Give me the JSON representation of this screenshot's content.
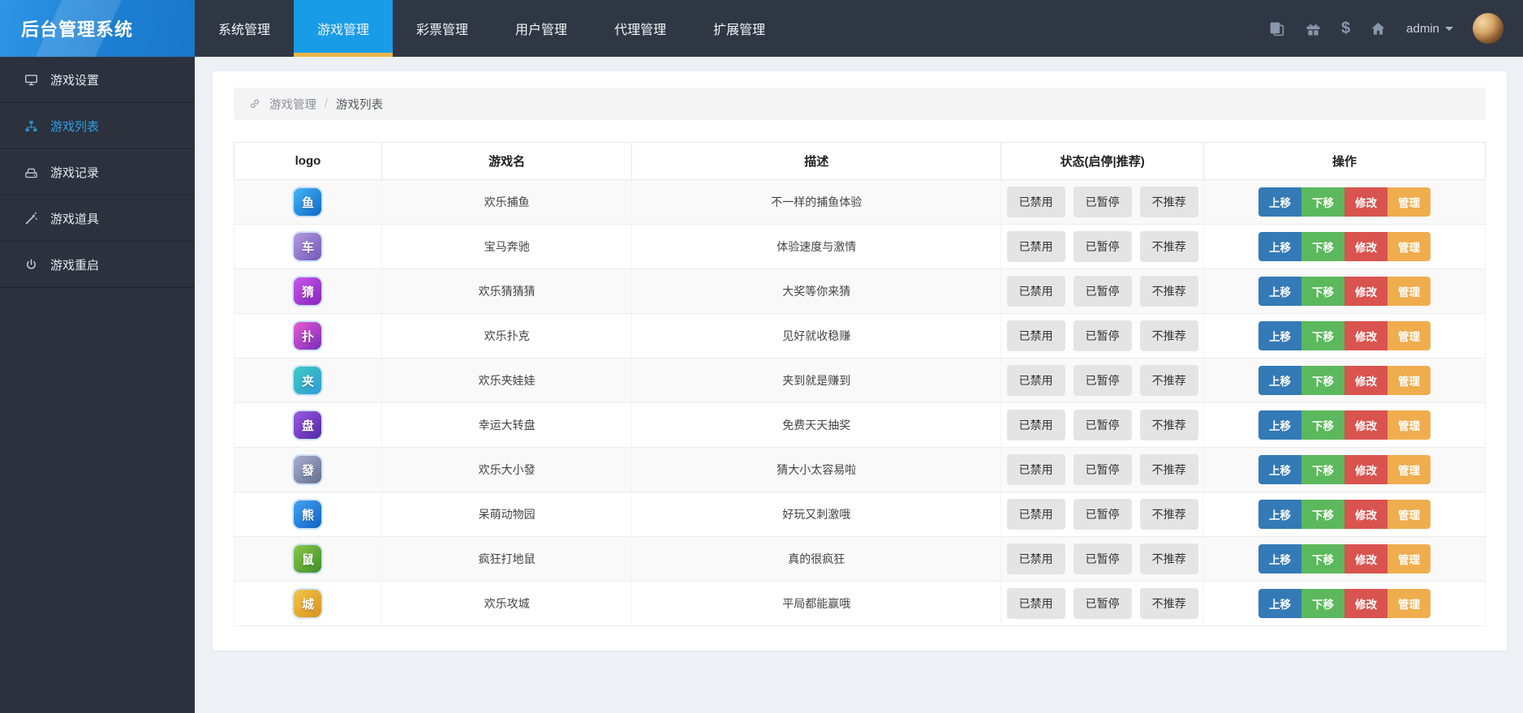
{
  "app": {
    "title": "后台管理系统"
  },
  "topnav": {
    "items": [
      {
        "label": "系统管理",
        "active": false
      },
      {
        "label": "游戏管理",
        "active": true
      },
      {
        "label": "彩票管理",
        "active": false
      },
      {
        "label": "用户管理",
        "active": false
      },
      {
        "label": "代理管理",
        "active": false
      },
      {
        "label": "扩展管理",
        "active": false
      }
    ],
    "glyphs": {
      "dollar": "$"
    },
    "user": {
      "name": "admin"
    }
  },
  "sidebar": {
    "items": [
      {
        "label": "游戏设置",
        "icon": "desktop-icon",
        "active": false
      },
      {
        "label": "游戏列表",
        "icon": "sitemap-icon",
        "active": true
      },
      {
        "label": "游戏记录",
        "icon": "drive-icon",
        "active": false
      },
      {
        "label": "游戏道具",
        "icon": "wand-icon",
        "active": false
      },
      {
        "label": "游戏重启",
        "icon": "power-icon",
        "active": false
      }
    ]
  },
  "breadcrumb": {
    "parent": "游戏管理",
    "separator": "/",
    "current": "游戏列表"
  },
  "table": {
    "headers": [
      "logo",
      "游戏名",
      "描述",
      "状态(启停|推荐)",
      "操作"
    ],
    "status_buttons": [
      "已禁用",
      "已暂停",
      "不推荐"
    ],
    "action_buttons": [
      "上移",
      "下移",
      "修改",
      "管理"
    ],
    "rows": [
      {
        "name": "欢乐捕鱼",
        "desc": "不一样的捕鱼体验",
        "logo": {
          "char": "鱼",
          "c1": "#45b6f2",
          "c2": "#0d68c8"
        }
      },
      {
        "name": "宝马奔驰",
        "desc": "体验速度与激情",
        "logo": {
          "char": "车",
          "c1": "#b49ae0",
          "c2": "#7458b8"
        }
      },
      {
        "name": "欢乐猜猜猜",
        "desc": "大奖等你来猜",
        "logo": {
          "char": "猜",
          "c1": "#c85ae8",
          "c2": "#8822c0"
        }
      },
      {
        "name": "欢乐扑克",
        "desc": "见好就收稳赚",
        "logo": {
          "char": "扑",
          "c1": "#e85ad0",
          "c2": "#7a2cc0"
        }
      },
      {
        "name": "欢乐夹娃娃",
        "desc": "夹到就是赚到",
        "logo": {
          "char": "夹",
          "c1": "#3ecbc0",
          "c2": "#2e9ad8"
        }
      },
      {
        "name": "幸运大转盘",
        "desc": "免费天天抽奖",
        "logo": {
          "char": "盘",
          "c1": "#9a5ae0",
          "c2": "#5228a8"
        }
      },
      {
        "name": "欢乐大小發",
        "desc": "猜大小太容易啦",
        "logo": {
          "char": "發",
          "c1": "#a8aed0",
          "c2": "#666e90"
        }
      },
      {
        "name": "呆萌动物园",
        "desc": "好玩又刺激哦",
        "logo": {
          "char": "熊",
          "c1": "#42a6f0",
          "c2": "#1060c8"
        }
      },
      {
        "name": "疯狂打地鼠",
        "desc": "真的很疯狂",
        "logo": {
          "char": "鼠",
          "c1": "#8ac84a",
          "c2": "#3e8f28"
        }
      },
      {
        "name": "欢乐攻城",
        "desc": "平局都能赢哦",
        "logo": {
          "char": "城",
          "c1": "#f2c54a",
          "c2": "#d8921e"
        }
      }
    ]
  },
  "colors": {
    "topbar_bg": "#2f3744",
    "sidebar_bg": "#2b313d",
    "accent_blue": "#189ce8",
    "tab_underline": "#e9b64a",
    "sidebar_active": "#2d9fe8",
    "status_button_bg": "#e4e4e4",
    "action_up": "#337ab7",
    "action_down": "#5cb85c",
    "action_edit": "#d9534f",
    "action_manage": "#f0ad4e"
  }
}
